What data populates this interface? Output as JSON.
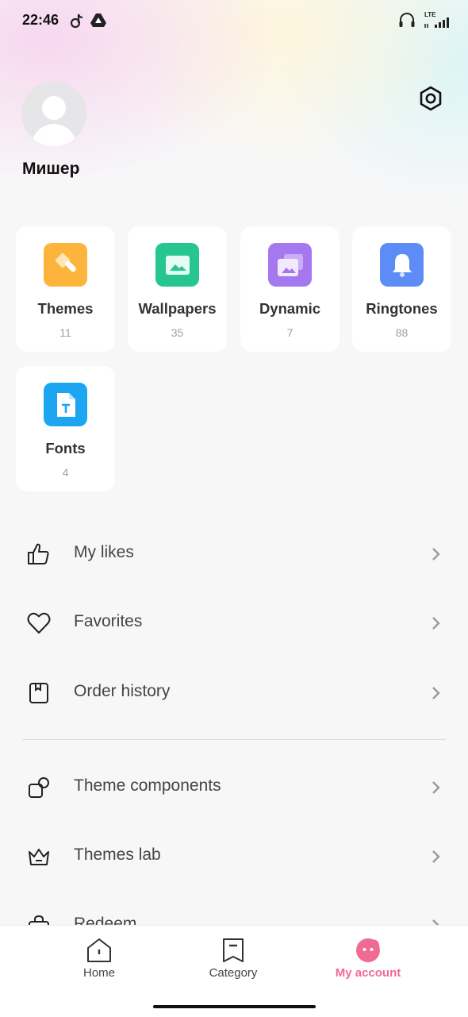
{
  "status_bar": {
    "time": "22:46",
    "network_label": "LTE",
    "icons": [
      "tiktok-icon",
      "google-drive-icon",
      "headphones-icon",
      "signal-icon"
    ]
  },
  "profile": {
    "name": "Мишер"
  },
  "categories": [
    {
      "label": "Themes",
      "count": "11",
      "color": "#fdb43c",
      "icon": "brush-icon"
    },
    {
      "label": "Wallpapers",
      "count": "35",
      "color": "#25c690",
      "icon": "image-icon"
    },
    {
      "label": "Dynamic",
      "count": "7",
      "color": "#a678ef",
      "icon": "layers-icon"
    },
    {
      "label": "Ringtones",
      "count": "88",
      "color": "#5d8cf6",
      "icon": "bell-icon"
    },
    {
      "label": "Fonts",
      "count": "4",
      "color": "#1ca6f2",
      "icon": "font-file-icon"
    }
  ],
  "menu": {
    "group1": [
      {
        "label": "My likes",
        "icon": "thumbs-up-icon"
      },
      {
        "label": "Favorites",
        "icon": "heart-icon"
      },
      {
        "label": "Order history",
        "icon": "bookmark-box-icon"
      }
    ],
    "group2": [
      {
        "label": "Theme components",
        "icon": "components-icon"
      },
      {
        "label": "Themes lab",
        "icon": "crown-icon"
      },
      {
        "label": "Redeem",
        "icon": "bag-icon"
      }
    ]
  },
  "bottom_nav": [
    {
      "label": "Home",
      "active": false
    },
    {
      "label": "Category",
      "active": false
    },
    {
      "label": "My account",
      "active": true
    }
  ],
  "colors": {
    "accent": "#f06b93"
  }
}
